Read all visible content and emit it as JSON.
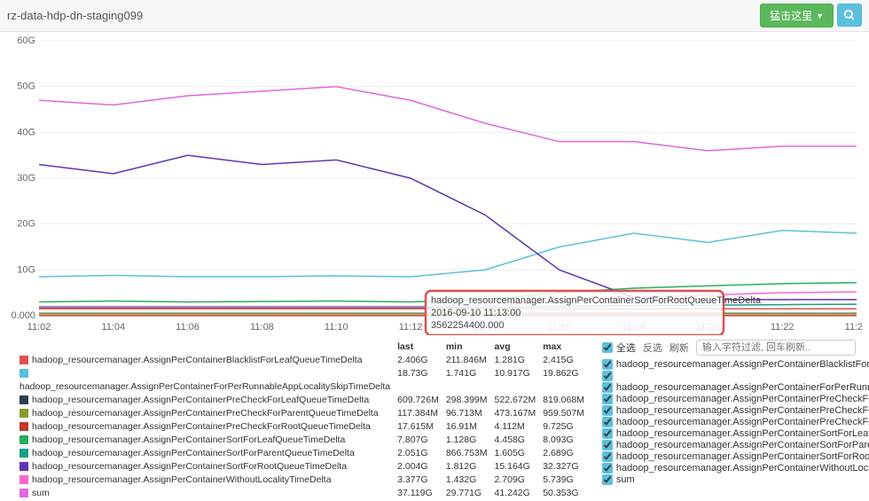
{
  "header": {
    "title": "rz-data-hdp-dn-staging099",
    "action_label": "猛击这里",
    "search_icon_name": "search-icon"
  },
  "chart_data": {
    "type": "line",
    "xlabel": "",
    "ylabel": "",
    "title": "",
    "x_ticks": [
      "11:02",
      "11:04",
      "11:06",
      "11:08",
      "11:10",
      "11:12",
      "11:14",
      "11:16",
      "11:18",
      "11:20",
      "11:22",
      "11:24"
    ],
    "y_ticks": [
      "0.000",
      "10G",
      "20G",
      "30G",
      "40G",
      "50G",
      "60G"
    ],
    "ylim": [
      0,
      60
    ],
    "series": [
      {
        "name": "hadoop_resourcemanager.AssignPerContainerBlacklistForLeafQueueTimeDelta",
        "color": "#d9534f",
        "values": [
          1.5,
          1.5,
          1.5,
          1.5,
          1.5,
          1.5,
          1.5,
          1.5,
          1.5,
          1.5,
          1.5,
          1.5
        ]
      },
      {
        "name": "hadoop_resourcemanager.AssignPerContainerForPerRunnableAppLocalitySkipTimeDelta",
        "color": "#5bc0de",
        "values": [
          8.5,
          8.8,
          8.5,
          8.5,
          8.7,
          8.5,
          10,
          15,
          18,
          16,
          18.6,
          18
        ]
      },
      {
        "name": "hadoop_resourcemanager.AssignPerContainerPreCheckForLeafQueueTimeDelta",
        "color": "#2e3e4e",
        "values": [
          0.5,
          0.5,
          0.5,
          0.5,
          0.5,
          0.5,
          0.5,
          0.5,
          0.5,
          0.5,
          0.5,
          0.5
        ]
      },
      {
        "name": "hadoop_resourcemanager.AssignPerContainerPreCheckForParentQueueTimeDelta",
        "color": "#8a9a27",
        "values": [
          0.4,
          0.4,
          0.4,
          0.4,
          0.4,
          0.4,
          0.4,
          0.4,
          0.4,
          0.4,
          0.4,
          0.4
        ]
      },
      {
        "name": "hadoop_resourcemanager.AssignPerContainerPreCheckForRootQueueTimeDelta",
        "color": "#c0392b",
        "values": [
          0.03,
          0.03,
          0.03,
          0.03,
          0.03,
          0.03,
          0.03,
          0.03,
          0.03,
          0.03,
          0.03,
          0.03
        ]
      },
      {
        "name": "hadoop_resourcemanager.AssignPerContainerSortForLeafQueueTimeDelta",
        "color": "#27ae60",
        "values": [
          3,
          3.2,
          3,
          3.1,
          3.2,
          3,
          3.5,
          5,
          6,
          6.5,
          7,
          7.2
        ]
      },
      {
        "name": "hadoop_resourcemanager.AssignPerContainerSortForParentQueueTimeDelta",
        "color": "#16a085",
        "values": [
          1.8,
          1.8,
          1.8,
          1.8,
          1.8,
          1.8,
          1.8,
          2,
          2.2,
          2.3,
          2.4,
          2.5
        ]
      },
      {
        "name": "hadoop_resourcemanager.AssignPerContainerSortForRootQueueTimeDelta",
        "color": "#5e35b1",
        "values": [
          33,
          31,
          35,
          33,
          34,
          30,
          22,
          10,
          4,
          3.5,
          3.5,
          3.5
        ]
      },
      {
        "name": "hadoop_resourcemanager.AssignPerContainerWithoutLocalityTimeDelta",
        "color": "#ff66cc",
        "values": [
          2,
          2,
          2,
          2,
          2,
          2,
          2.2,
          3,
          4,
          4.5,
          5,
          5.2
        ]
      },
      {
        "name": "sum",
        "color": "#e066e0",
        "values": [
          47,
          46,
          48,
          49,
          50,
          47,
          42,
          38,
          38,
          36,
          37,
          37
        ]
      }
    ]
  },
  "tooltip": {
    "metric": "hadoop_resourcemanager.AssignPerContainerSortForRootQueueTimeDelta",
    "timestamp": "2016-09-10 11:13:00",
    "value": "3562254400.000"
  },
  "stats": {
    "headers": [
      "last",
      "min",
      "avg",
      "max"
    ],
    "rows": [
      {
        "color": "#d9534f",
        "name": "hadoop_resourcemanager.AssignPerContainerBlacklistForLeafQueueTimeDelta",
        "last": "2.406G",
        "min": "211.846M",
        "avg": "1.281G",
        "max": "2.415G"
      },
      {
        "color": "#5bc0de",
        "name": "",
        "last": "18.73G",
        "min": "1.741G",
        "avg": "10.917G",
        "max": "19.862G"
      },
      {
        "color": "",
        "name": "hadoop_resourcemanager.AssignPerContainerForPerRunnableAppLocalitySkipTimeDelta",
        "last": "",
        "min": "",
        "avg": "",
        "max": ""
      },
      {
        "color": "#2e3e4e",
        "name": "hadoop_resourcemanager.AssignPerContainerPreCheckForLeafQueueTimeDelta",
        "last": "609.726M",
        "min": "298.399M",
        "avg": "522.672M",
        "max": "819.068M"
      },
      {
        "color": "#8a9a27",
        "name": "hadoop_resourcemanager.AssignPerContainerPreCheckForParentQueueTimeDelta",
        "last": "117.384M",
        "min": "96.713M",
        "avg": "473.167M",
        "max": "959.507M"
      },
      {
        "color": "#c0392b",
        "name": "hadoop_resourcemanager.AssignPerContainerPreCheckForRootQueueTimeDelta",
        "last": "17.615M",
        "min": "16.91M",
        "avg": "4.112M",
        "max": "9.725G"
      },
      {
        "color": "#27ae60",
        "name": "hadoop_resourcemanager.AssignPerContainerSortForLeafQueueTimeDelta",
        "last": "7.807G",
        "min": "1.128G",
        "avg": "4.458G",
        "max": "8.093G"
      },
      {
        "color": "#16a085",
        "name": "hadoop_resourcemanager.AssignPerContainerSortForParentQueueTimeDelta",
        "last": "2.051G",
        "min": "866.753M",
        "avg": "1.605G",
        "max": "2.689G"
      },
      {
        "color": "#5e35b1",
        "name": "hadoop_resourcemanager.AssignPerContainerSortForRootQueueTimeDelta",
        "last": "2.004G",
        "min": "1.812G",
        "avg": "15.164G",
        "max": "32.327G"
      },
      {
        "color": "#ff66cc",
        "name": "hadoop_resourcemanager.AssignPerContainerWithoutLocalityTimeDelta",
        "last": "3.377G",
        "min": "1.432G",
        "avg": "2.709G",
        "max": "5.739G"
      },
      {
        "color": "#e066e0",
        "name": "sum",
        "last": "37.119G",
        "min": "29.771G",
        "avg": "41.242G",
        "max": "50.353G"
      }
    ]
  },
  "controls": {
    "select_all": "全选",
    "invert": "反选",
    "refresh": "刷新",
    "filter_placeholder": "输入字符过滤, 回车刷新..",
    "checkboxes": [
      "hadoop_resourcemanager.AssignPerContainerBlacklistForLeafQueueTimeDelta",
      "",
      "hadoop_resourcemanager.AssignPerContainerForPerRunnableAppLocalitySkipTimeDelta",
      "hadoop_resourcemanager.AssignPerContainerPreCheckForLeafQueueTimeDelta",
      "hadoop_resourcemanager.AssignPerContainerPreCheckForParentQueueTimeDelta",
      "hadoop_resourcemanager.AssignPerContainerPreCheckForRootQueueTimeDelta",
      "hadoop_resourcemanager.AssignPerContainerSortForLeafQueueTimeDelta",
      "hadoop_resourcemanager.AssignPerContainerSortForParentQueueTimeDelta",
      "hadoop_resourcemanager.AssignPerContainerSortForRootQueueTimeDelta",
      "hadoop_resourcemanager.AssignPerContainerWithoutLocalityTimeDelta",
      "sum"
    ]
  }
}
